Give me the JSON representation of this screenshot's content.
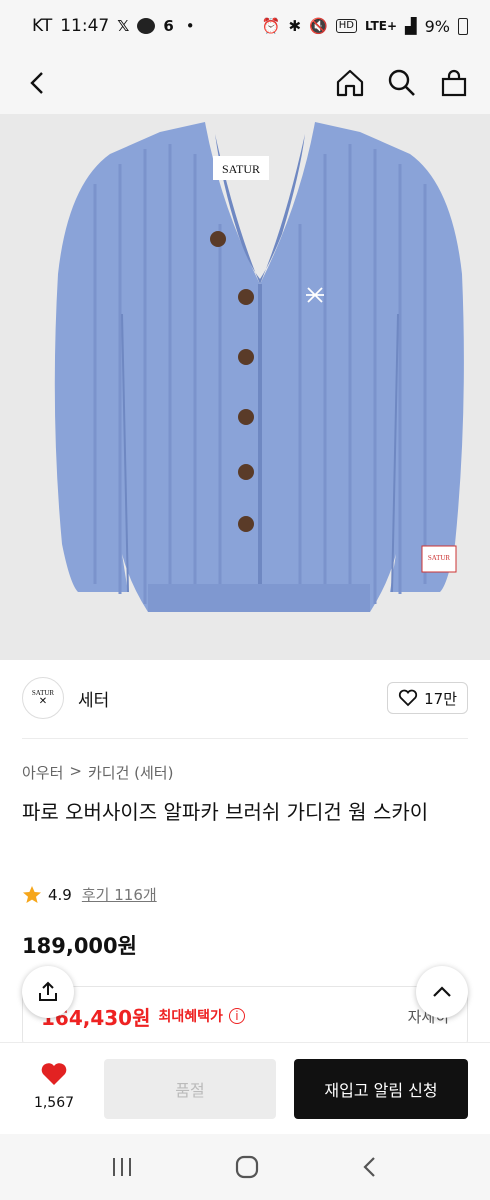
{
  "status": {
    "carrier": "KT",
    "time": "11:47",
    "left_icons": [
      "x-logo-icon",
      "talk-bubble-icon",
      "six-icon",
      "dot-icon"
    ],
    "right_icons": [
      "alarm-icon",
      "bluetooth-icon",
      "mute-icon",
      "hd-icon",
      "signal-icon"
    ],
    "network": "LTE+",
    "battery": "9%"
  },
  "header": {
    "icons": [
      "back-icon",
      "home-icon",
      "search-icon",
      "bag-icon"
    ]
  },
  "product_image": {
    "brand_tag": "SATUR",
    "sleeve_tag": "SATUR",
    "color": "#8aa3d8"
  },
  "shop": {
    "logo_text": "SATUR",
    "name": "세터",
    "likes": "17만"
  },
  "breadcrumb": {
    "first": "아우터",
    "separator": ">",
    "second": "카디건 (세터)"
  },
  "product": {
    "title": "파로 오버사이즈 알파카 브러쉬 가디건 웜 스카이",
    "rating": "4.9",
    "reviews": "후기 116개",
    "price": "189,000원"
  },
  "benefit": {
    "price": "164,430원",
    "label": "최대혜택가",
    "info_icon": "i",
    "detail": "자세히"
  },
  "bottom": {
    "wish_count": "1,567",
    "soldout_label": "품절",
    "restock_label": "재입고 알림 신청"
  },
  "colors": {
    "accent_red": "#e22222",
    "dark": "#111111",
    "star": "#f6a61a"
  }
}
